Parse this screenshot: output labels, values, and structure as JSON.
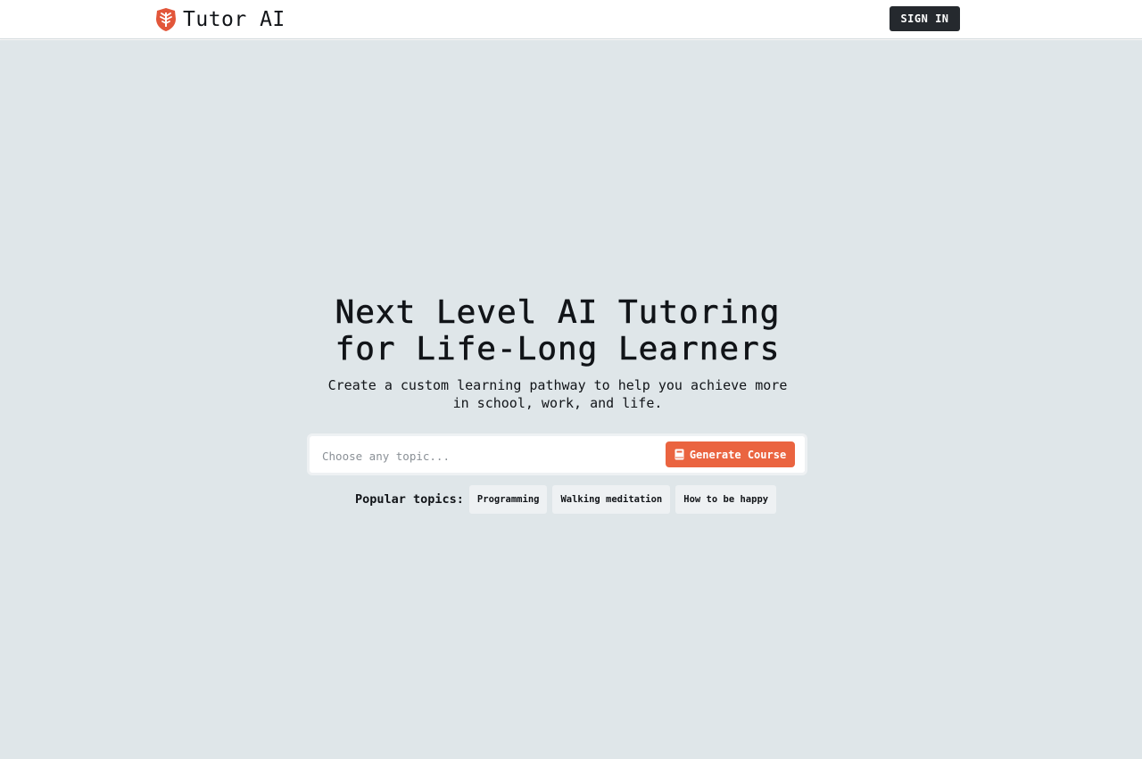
{
  "header": {
    "brand_name": "Tutor AI",
    "logo_icon": "tree-shield-icon",
    "sign_in_label": "SIGN IN"
  },
  "hero": {
    "title_line1": "Next Level AI Tutoring",
    "title_line2": "for Life-Long Learners",
    "subtitle": "Create a custom learning pathway to help you achieve more in school, work, and life."
  },
  "search": {
    "placeholder": "Choose any topic...",
    "value": "",
    "generate_label": "Generate Course",
    "generate_icon": "book-icon"
  },
  "popular": {
    "label": "Popular topics:",
    "topics": [
      "Programming",
      "Walking meditation",
      "How to be happy"
    ]
  },
  "colors": {
    "accent": "#ea6440",
    "dark_button": "#25292e",
    "background": "#dfe6e9",
    "chip_background": "#eef1f3"
  }
}
